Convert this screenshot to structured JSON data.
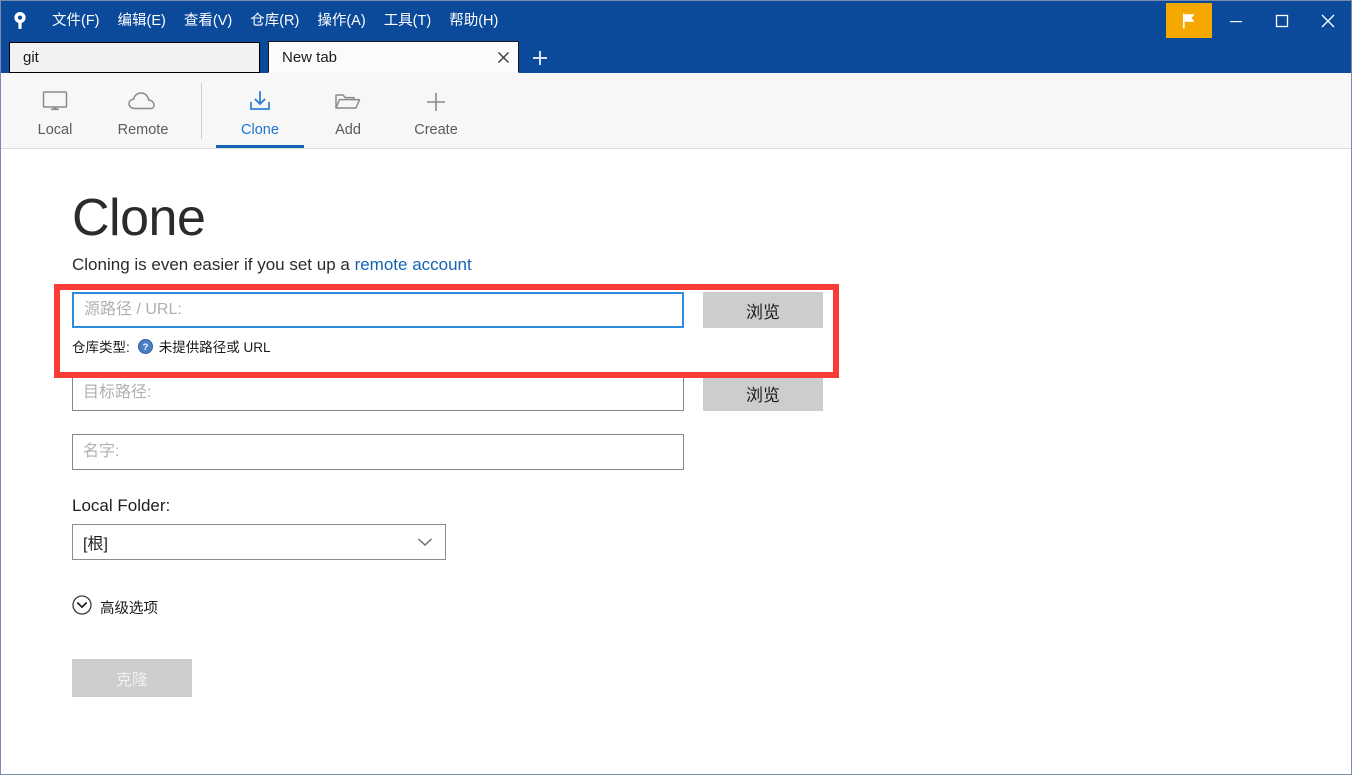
{
  "window": {
    "app_icon": "sourcetree-logo-icon",
    "menus": [
      {
        "label": "文件(F)",
        "name": "menu-file"
      },
      {
        "label": "编辑(E)",
        "name": "menu-edit"
      },
      {
        "label": "查看(V)",
        "name": "menu-view"
      },
      {
        "label": "仓库(R)",
        "name": "menu-repository"
      },
      {
        "label": "操作(A)",
        "name": "menu-actions"
      },
      {
        "label": "工具(T)",
        "name": "menu-tools"
      },
      {
        "label": "帮助(H)",
        "name": "menu-help"
      }
    ],
    "controls": {
      "flag_button": "flag-icon",
      "minimize": "−",
      "maximize": "▢",
      "close": "✕"
    },
    "colors": {
      "titlebar": "#0b4a9b",
      "flag_button": "#f5a800",
      "accent": "#1464b4",
      "highlight": "#fa3c37"
    }
  },
  "tabs": {
    "items": [
      {
        "label": "git",
        "active": false
      },
      {
        "label": "New tab",
        "active": true
      }
    ],
    "close_glyph": "✕",
    "new_tab_glyph": "+"
  },
  "toolbar": {
    "left_items": [
      {
        "label": "Local",
        "icon": "monitor-icon"
      },
      {
        "label": "Remote",
        "icon": "cloud-icon"
      }
    ],
    "right_items": [
      {
        "label": "Clone",
        "icon": "download-icon",
        "active": true
      },
      {
        "label": "Add",
        "icon": "folder-icon",
        "active": false
      },
      {
        "label": "Create",
        "icon": "plus-icon",
        "active": false
      }
    ]
  },
  "main": {
    "title": "Clone",
    "subtitle_prefix": "Cloning is even easier if you set up a ",
    "subtitle_link": "remote account",
    "source": {
      "placeholder": "源路径 / URL:",
      "value": "",
      "browse_label": "浏览",
      "repo_type_label": "仓库类型:",
      "repo_type_status": "未提供路径或 URL",
      "help_icon": "help-circle-icon"
    },
    "destination": {
      "placeholder": "目标路径:",
      "value": "",
      "browse_label": "浏览"
    },
    "name_field": {
      "placeholder": "名字:",
      "value": ""
    },
    "local_folder": {
      "label": "Local Folder:",
      "selected": "[根]",
      "chevron": "chevron-down-icon"
    },
    "advanced": {
      "label": "高级选项",
      "icon": "chevron-down-circle-icon"
    },
    "submit": {
      "label": "克隆",
      "disabled": true
    }
  }
}
